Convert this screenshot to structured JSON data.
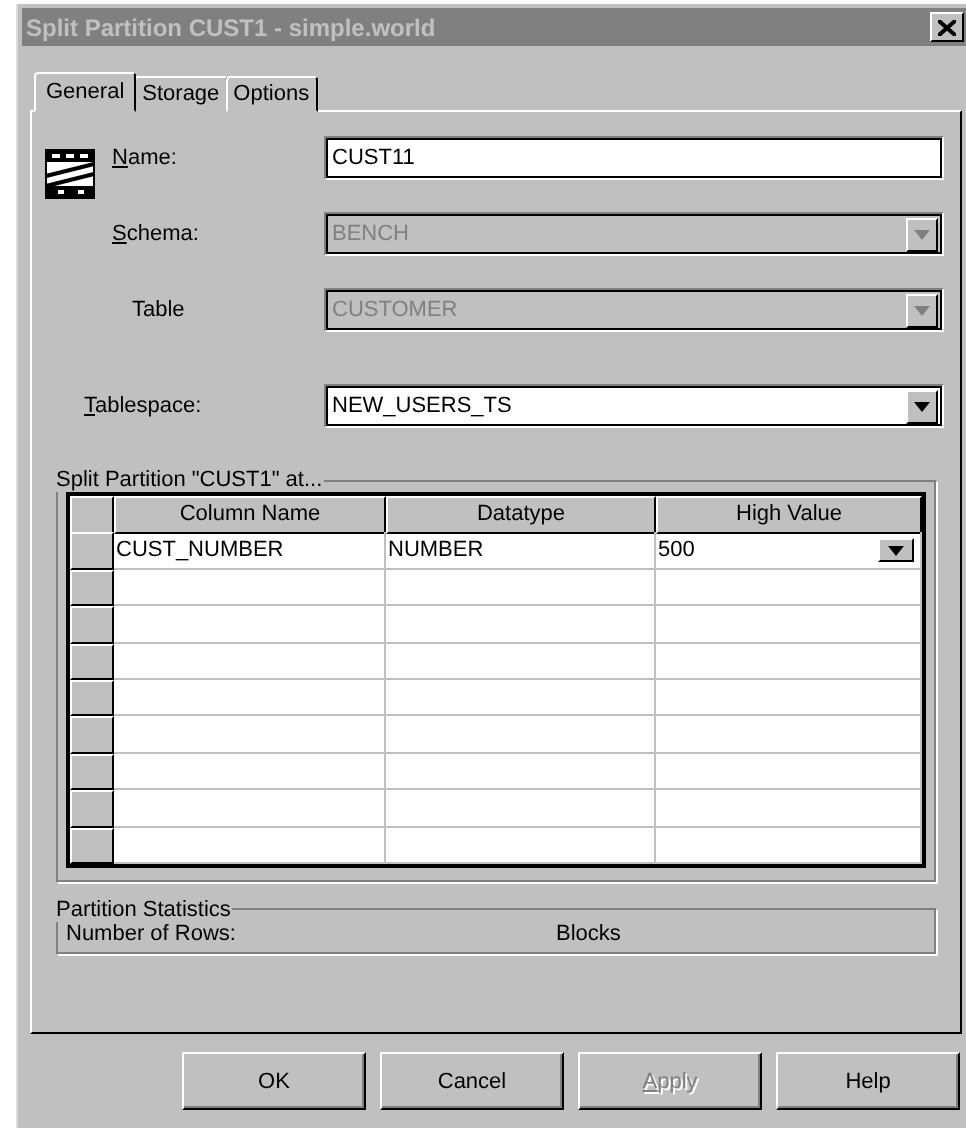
{
  "window": {
    "title": "Split Partition CUST1 - simple.world",
    "active": false
  },
  "tabs": [
    {
      "label": "General",
      "selected": true
    },
    {
      "label": "Storage",
      "selected": false
    },
    {
      "label": "Options",
      "selected": false
    }
  ],
  "fields": [
    {
      "label": {
        "mnemonic": "N",
        "rest": "ame:"
      },
      "value": "CUST11",
      "kind": "text",
      "disabled": false
    },
    {
      "label": {
        "mnemonic": "S",
        "rest": "chema:"
      },
      "value": "BENCH",
      "kind": "combo",
      "disabled": true
    },
    {
      "label": {
        "rest": "Table"
      },
      "value": "CUSTOMER",
      "kind": "combo",
      "disabled": true
    },
    {
      "label": {
        "mnemonic": "T",
        "rest": "ablespace:"
      },
      "value": "NEW_USERS_TS",
      "kind": "combo",
      "disabled": false
    }
  ],
  "split_group": {
    "title": "Split Partition \"CUST1\" at...",
    "columns": [
      "Column Name",
      "Datatype",
      "High Value"
    ],
    "rows": [
      {
        "cells": [
          "CUST_NUMBER",
          "NUMBER",
          "500"
        ],
        "dropdown": true
      }
    ]
  },
  "stats_group": {
    "title": "Partition Statistics",
    "rows_label": "Number of Rows:",
    "blocks_label": "Blocks"
  },
  "buttons": [
    {
      "label": {
        "rest": "OK"
      },
      "disabled": false
    },
    {
      "label": {
        "rest": "Cancel"
      },
      "disabled": false
    },
    {
      "label": {
        "mnemonic": "A",
        "rest": "pply"
      },
      "disabled": true
    },
    {
      "label": {
        "rest": "Help"
      },
      "disabled": false
    }
  ]
}
